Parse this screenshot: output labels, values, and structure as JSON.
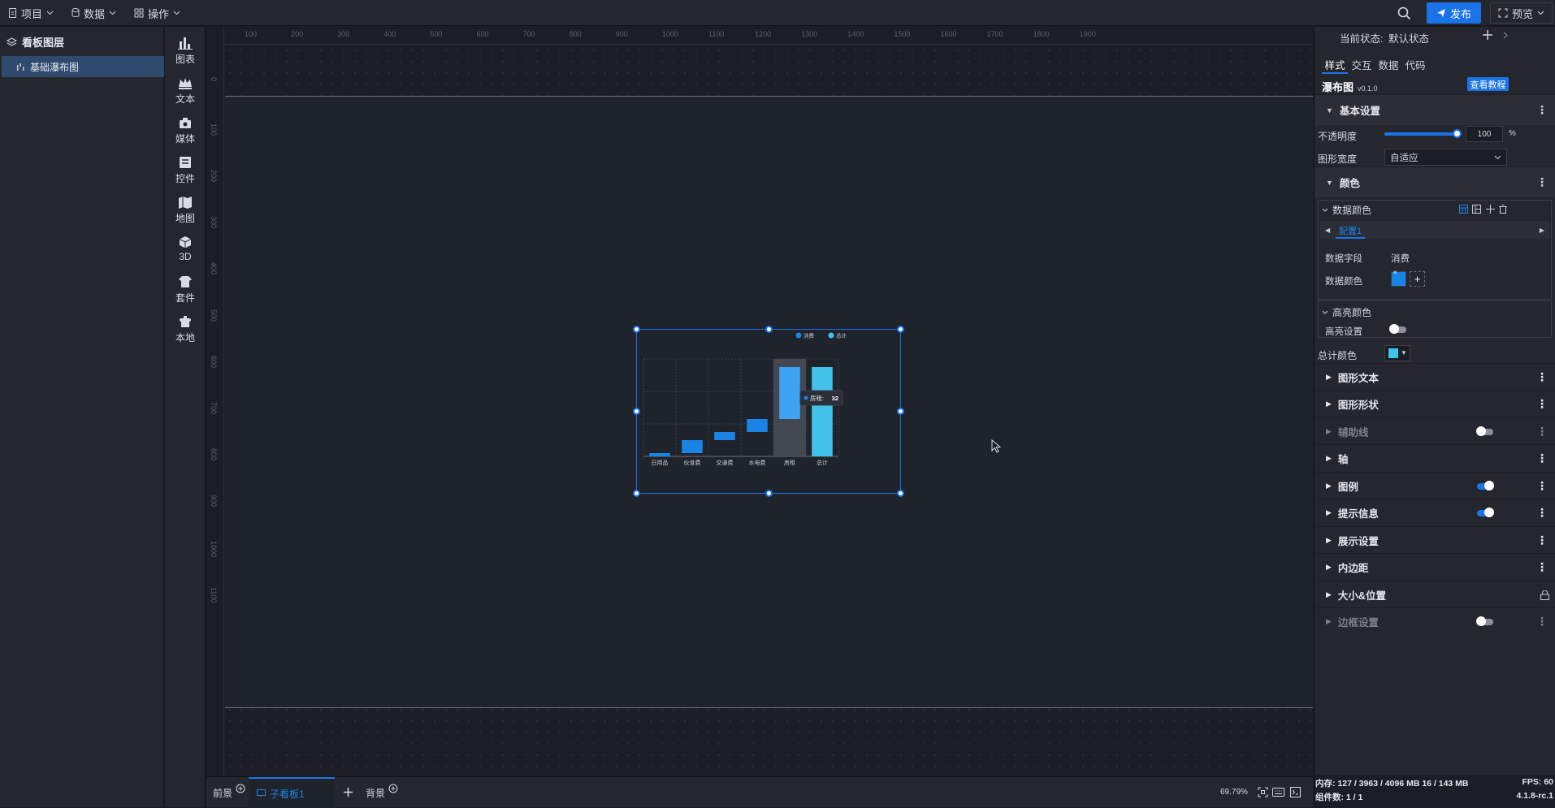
{
  "topbar": {
    "menu_project": "项目",
    "menu_data": "数据",
    "menu_ops": "操作",
    "publish": "发布",
    "preview": "预览"
  },
  "layers": {
    "title": "看板图层",
    "items": [
      {
        "label": "基础瀑布图"
      }
    ]
  },
  "tools": [
    {
      "label": "图表",
      "icon": "chart-icon"
    },
    {
      "label": "文本",
      "icon": "text-icon"
    },
    {
      "label": "媒体",
      "icon": "media-icon"
    },
    {
      "label": "控件",
      "icon": "widget-icon"
    },
    {
      "label": "地图",
      "icon": "map-icon"
    },
    {
      "label": "3D",
      "icon": "cube-icon"
    },
    {
      "label": "套件",
      "icon": "suite-icon"
    },
    {
      "label": "本地",
      "icon": "local-icon"
    }
  ],
  "ruler": {
    "h_ticks": [
      "100",
      "200",
      "300",
      "400",
      "500",
      "600",
      "700",
      "800",
      "900",
      "1000",
      "1100",
      "1200",
      "1300",
      "1400",
      "1500",
      "1600",
      "1700",
      "1800",
      "1900"
    ],
    "v_ticks": [
      "0",
      "100",
      "200",
      "300",
      "400",
      "500",
      "600",
      "700",
      "800",
      "900",
      "1000",
      "1100"
    ]
  },
  "chart_data": {
    "type": "bar",
    "subtype": "waterfall",
    "categories": [
      "日用品",
      "伙食费",
      "交通费",
      "水电费",
      "房租",
      "总计"
    ],
    "series": [
      {
        "name": "消费",
        "values": [
          2,
          8,
          5,
          8,
          32,
          null
        ],
        "color": "#1a84e6"
      },
      {
        "name": "总计",
        "values": [
          null,
          null,
          null,
          null,
          null,
          55
        ],
        "color": "#42c1eb"
      }
    ],
    "base": [
      0,
      2,
      10,
      15,
      23,
      0
    ],
    "ylim": [
      0,
      60
    ],
    "legend": "top-right",
    "tooltip": {
      "label": "房租",
      "value": "32"
    },
    "highlight_category": "房租"
  },
  "bottombar": {
    "front": "前景",
    "sub_board": "子看板1",
    "background": "背景",
    "zoom": "69.79%"
  },
  "rpanel": {
    "state_label": "当前状态:",
    "state_value": "默认状态",
    "tabs": [
      "样式",
      "交互",
      "数据",
      "代码"
    ],
    "component_name": "瀑布图",
    "version": "v0.1.0",
    "tutorial": "查看教程",
    "basic": "基本设置",
    "opacity_label": "不透明度",
    "opacity_value": "100",
    "opacity_unit": "%",
    "width_label": "图形宽度",
    "width_value": "自适应",
    "color": "颜色",
    "data_color": "数据颜色",
    "config": "配置1",
    "data_field_label": "数据字段",
    "data_field_value": "消费",
    "data_color_label": "数据颜色",
    "highlight_color": "高亮颜色",
    "highlight_setting": "高亮设置",
    "total_color": "总计颜色",
    "sections": [
      {
        "label": "图形文本"
      },
      {
        "label": "图形形状"
      },
      {
        "label": "辅助线"
      },
      {
        "label": "轴"
      },
      {
        "label": "图例"
      },
      {
        "label": "提示信息"
      },
      {
        "label": "展示设置"
      },
      {
        "label": "内边距"
      },
      {
        "label": "大小&位置"
      },
      {
        "label": "边框设置"
      }
    ],
    "colors": {
      "accent": "#1a73e8",
      "data": "#1a84e6",
      "total": "#42c1eb"
    }
  },
  "status": {
    "memory": "内存:  127 / 3963 / 4096 MB  16 / 143 MB",
    "fps": "FPS:  60",
    "components": "组件数: 1 / 1",
    "version": "4.1.8-rc.1"
  }
}
